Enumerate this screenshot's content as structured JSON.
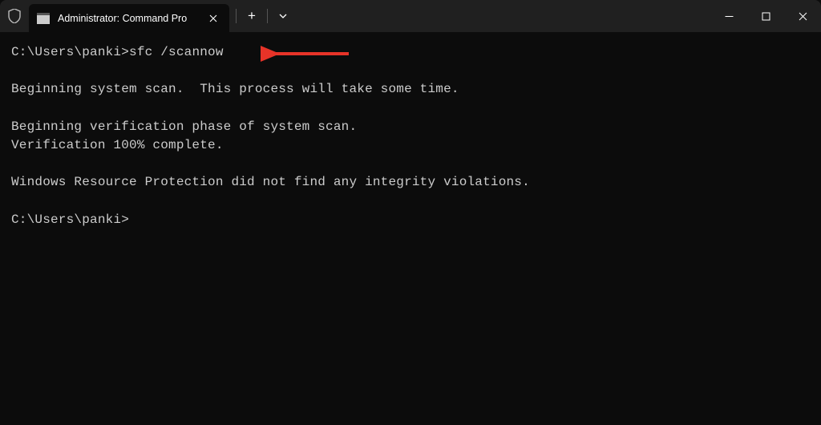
{
  "titlebar": {
    "tab_title": "Administrator: Command Pro"
  },
  "terminal": {
    "prompt1": "C:\\Users\\panki>",
    "command": "sfc /scannow",
    "blank1": "",
    "line1": "Beginning system scan.  This process will take some time.",
    "blank2": "",
    "line2": "Beginning verification phase of system scan.",
    "line3": "Verification 100% complete.",
    "blank3": "",
    "line4": "Windows Resource Protection did not find any integrity violations.",
    "blank4": "",
    "prompt2": "C:\\Users\\panki>"
  },
  "colors": {
    "annotation_arrow": "#e73328"
  }
}
